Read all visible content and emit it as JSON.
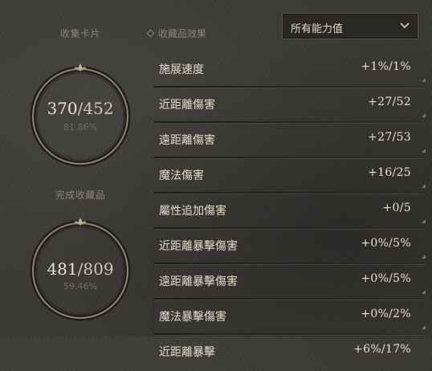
{
  "left": {
    "cards_label": "收集卡片",
    "cards_count": "370",
    "cards_max": "/452",
    "cards_pct": "81.86%",
    "cards_fill": 0.8186,
    "items_label": "完成收藏品",
    "items_count": "481",
    "items_max": "/809",
    "items_pct": "59.46%",
    "items_fill": 0.5946
  },
  "header": {
    "title": "收藏品效果",
    "dropdown_value": "所有能力值"
  },
  "stats": [
    {
      "name": "施展速度",
      "value": "+1%/1%"
    },
    {
      "name": "近距離傷害",
      "value": "+27/52"
    },
    {
      "name": "遠距離傷害",
      "value": "+27/53"
    },
    {
      "name": "魔法傷害",
      "value": "+16/25"
    },
    {
      "name": "屬性追加傷害",
      "value": "+0/5"
    },
    {
      "name": "近距離暴擊傷害",
      "value": "+0%/5%"
    },
    {
      "name": "遠距離暴擊傷害",
      "value": "+0%/5%"
    },
    {
      "name": "魔法暴擊傷害",
      "value": "+0%/2%"
    },
    {
      "name": "近距離暴擊",
      "value": "+6%/17%"
    }
  ],
  "colors": {
    "accent": "#d9d2c3",
    "ring": "#b5aa94"
  },
  "icons": [
    "diamond-icon",
    "chevron-down-icon",
    "fleur-icon"
  ]
}
